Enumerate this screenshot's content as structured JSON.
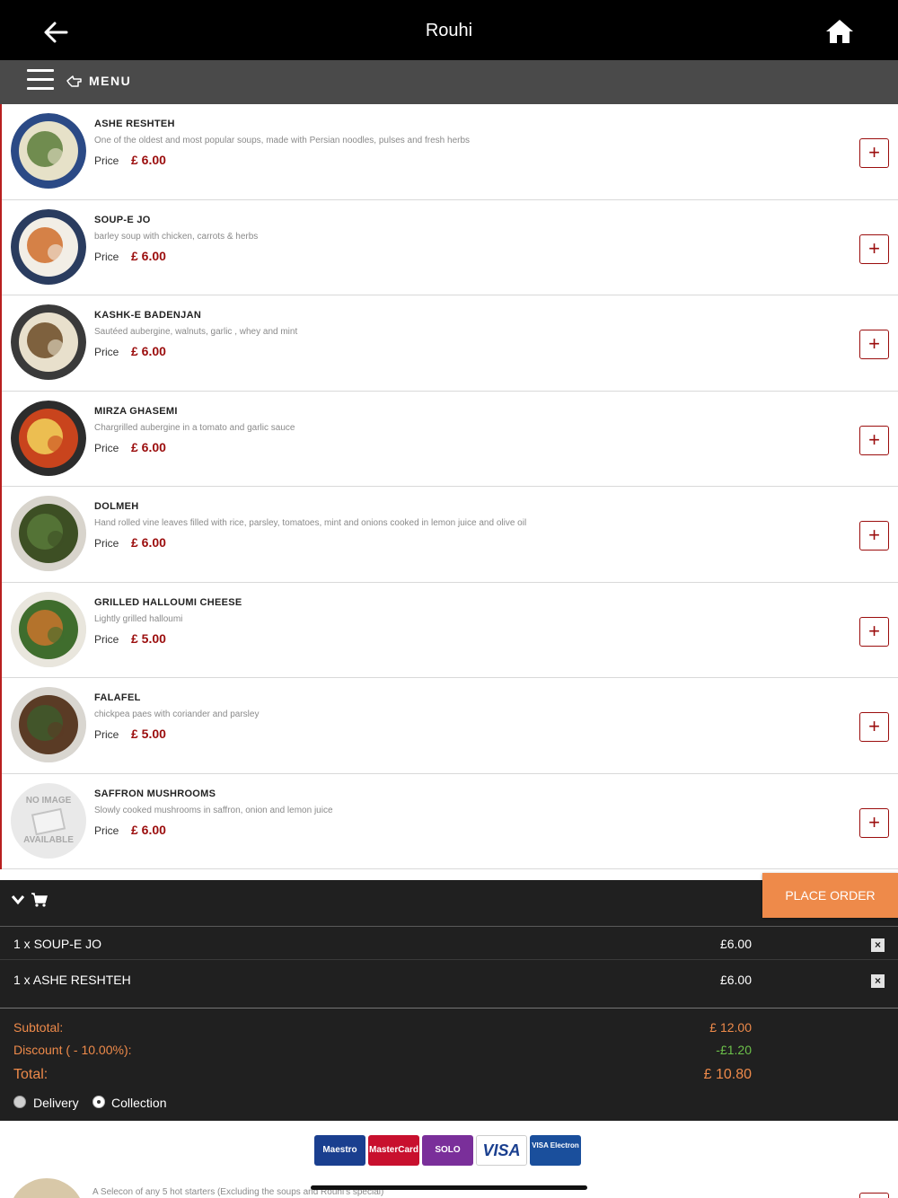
{
  "header": {
    "title": "Rouhi"
  },
  "menubar": {
    "label": "MENU"
  },
  "items": [
    {
      "name": "ASHE RESHTEH",
      "desc": "One of the oldest and most popular soups, made with Persian noodles, pulses and fresh herbs",
      "price_label": "Price",
      "price": "£ 6.00",
      "colors": [
        "#2b4a86",
        "#e6e1c8",
        "#5b7c39"
      ]
    },
    {
      "name": "SOUP-E JO",
      "desc": "barley soup with chicken, carrots & herbs",
      "price_label": "Price",
      "price": "£ 6.00",
      "colors": [
        "#2a3c5f",
        "#f2eee6",
        "#d06d2a"
      ]
    },
    {
      "name": "KASHK-E BADENJAN",
      "desc": "Sautéed aubergine, walnuts, garlic , whey and mint",
      "price_label": "Price",
      "price": "£ 6.00",
      "colors": [
        "#3a3a3a",
        "#e8e0cc",
        "#6b4a25"
      ]
    },
    {
      "name": "MIRZA GHASEMI",
      "desc": "Chargrilled aubergine in a tomato and garlic sauce",
      "price_label": "Price",
      "price": "£ 6.00",
      "colors": [
        "#2c2c2c",
        "#c9441d",
        "#f2d35a"
      ]
    },
    {
      "name": "DOLMEH",
      "desc": "Hand rolled vine leaves filled with rice, parsley, tomatoes, mint and onions cooked in lemon juice and olive oil",
      "price_label": "Price",
      "price": "£ 6.00",
      "colors": [
        "#d8d4cc",
        "#3d4f24",
        "#58793a"
      ]
    },
    {
      "name": "GRILLED HALLOUMI CHEESE",
      "desc": "Lightly grilled halloumi",
      "price_label": "Price",
      "price": "£ 5.00",
      "colors": [
        "#e9e6dd",
        "#3f6d2d",
        "#c9742d"
      ]
    },
    {
      "name": "FALAFEL",
      "desc": "chickpea paes with coriander and parsley",
      "price_label": "Price",
      "price": "£ 5.00",
      "colors": [
        "#d9d6d0",
        "#5a3b25",
        "#3e5a2c"
      ]
    },
    {
      "name": "SAFFRON MUSHROOMS",
      "desc": "Slowly cooked mushrooms in saffron, onion and lemon juice",
      "price_label": "Price",
      "price": "£ 6.00",
      "noimage": true,
      "noimage_top": "NO IMAGE",
      "noimage_bottom": "AVAILABLE"
    }
  ],
  "cart": {
    "place_order": "PLACE ORDER",
    "lines": [
      {
        "qty_name": "1 x SOUP-E JO",
        "amount": "£6.00"
      },
      {
        "qty_name": "1 x ASHE RESHTEH",
        "amount": "£6.00"
      }
    ],
    "subtotal_label": "Subtotal:",
    "subtotal": "£ 12.00",
    "discount_label": "Discount ( - 10.00%):",
    "discount": "-£1.20",
    "total_label": "Total:",
    "total": "£ 10.80",
    "delivery_label": "Delivery",
    "collection_label": "Collection",
    "selected_option": "Collection"
  },
  "payment_cards": [
    {
      "label": "Maestro",
      "color": "#1a3f8f"
    },
    {
      "label": "MasterCard",
      "color": "#c8102e"
    },
    {
      "label": "SOLO",
      "color": "#7a2f9a"
    },
    {
      "label": "VISA",
      "color": "#ffffff"
    },
    {
      "label": "VISA Electron",
      "color": "#1a4f9c"
    }
  ],
  "peek_text": "A Selecon of any 5 hot starters (Excluding the soups and Rouhi's special)",
  "colors": {
    "accent": "#9b0d0d",
    "order": "#ee8a4a",
    "discount": "#6cc04a"
  }
}
